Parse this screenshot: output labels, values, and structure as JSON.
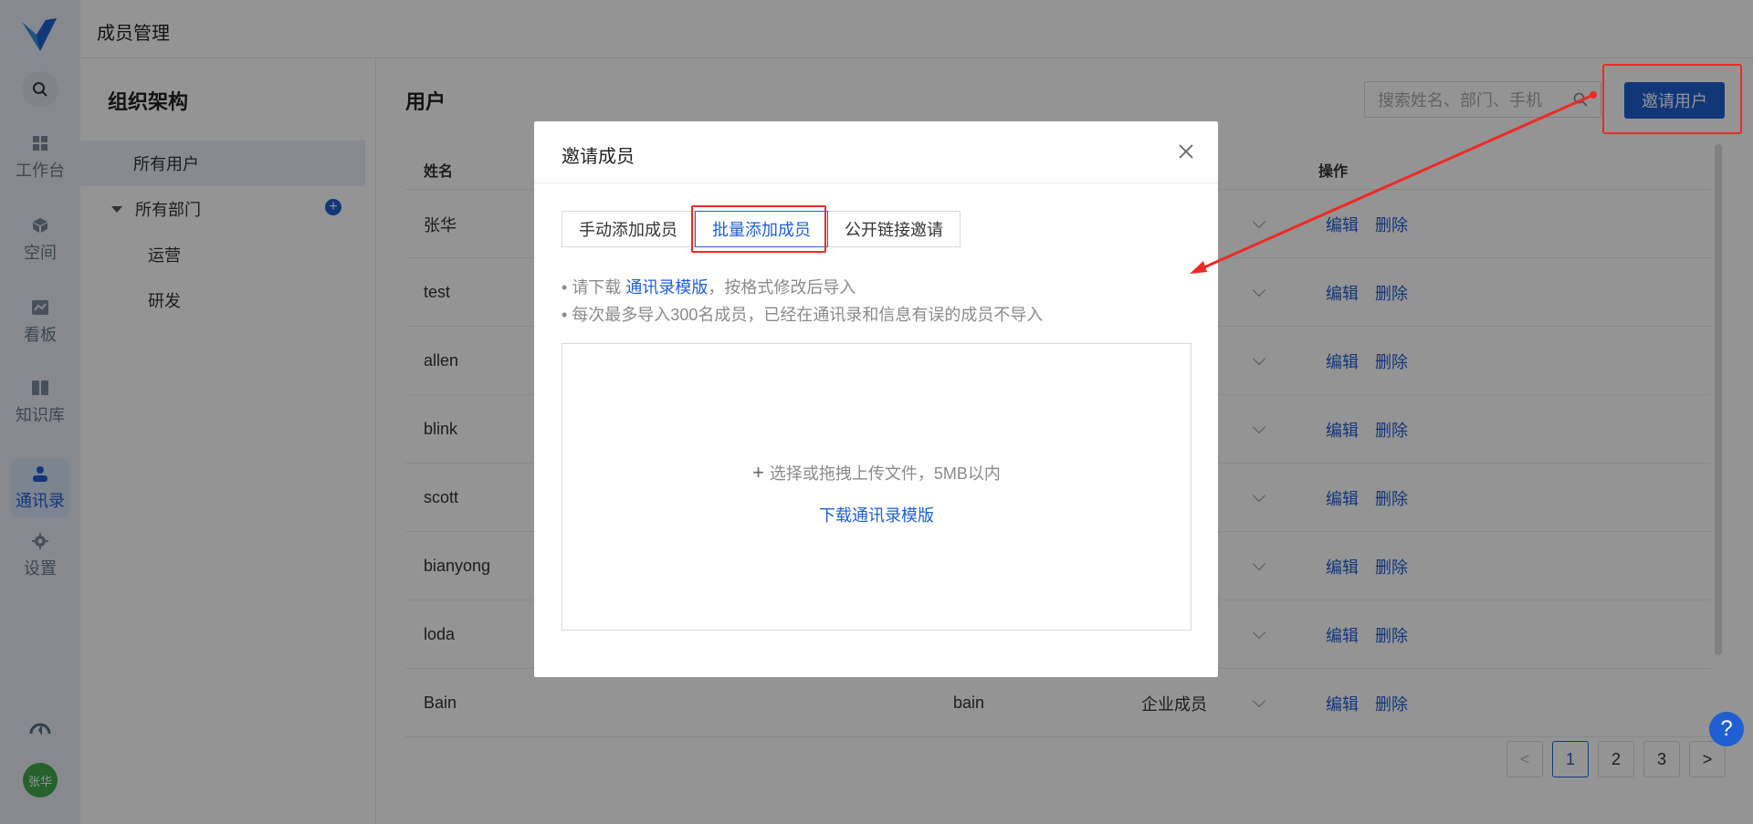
{
  "header": {
    "title": "成员管理"
  },
  "rail": {
    "items": [
      {
        "label": "工作台",
        "icon": "dashboard-icon"
      },
      {
        "label": "空间",
        "icon": "cube-icon"
      },
      {
        "label": "看板",
        "icon": "chart-icon"
      },
      {
        "label": "知识库",
        "icon": "book-icon"
      },
      {
        "label": "通讯录",
        "icon": "contacts-icon"
      },
      {
        "label": "设置",
        "icon": "gear-icon"
      }
    ],
    "avatar": "张华"
  },
  "org": {
    "title": "组织架构",
    "items": [
      {
        "label": "所有用户"
      },
      {
        "label": "所有部门"
      },
      {
        "label": "运营"
      },
      {
        "label": "研发"
      }
    ]
  },
  "main": {
    "title": "用户",
    "search_placeholder": "搜索姓名、部门、手机",
    "invite_label": "邀请用户",
    "columns": {
      "name": "姓名",
      "actions": "操作"
    },
    "rows": [
      {
        "name": "张华",
        "account": "",
        "role": ""
      },
      {
        "name": "test",
        "account": "",
        "role": ""
      },
      {
        "name": "allen",
        "account": "",
        "role": ""
      },
      {
        "name": "blink",
        "account": "",
        "role": ""
      },
      {
        "name": "scott",
        "account": "",
        "role": ""
      },
      {
        "name": "bianyong",
        "account": "",
        "role": ""
      },
      {
        "name": "loda",
        "account": "",
        "role": ""
      },
      {
        "name": "Bain",
        "account": "bain",
        "role": "企业成员"
      }
    ],
    "edit_label": "编辑",
    "delete_label": "删除",
    "pagination": {
      "prev": "<",
      "pages": [
        "1",
        "2",
        "3"
      ],
      "current": "1",
      "next": ">"
    },
    "help_label": "?"
  },
  "modal": {
    "title": "邀请成员",
    "tabs": [
      {
        "label": "手动添加成员"
      },
      {
        "label": "批量添加成员"
      },
      {
        "label": "公开链接邀请"
      }
    ],
    "hint1_prefix": "请下载",
    "hint1_link": "通讯录模版",
    "hint1_suffix": "，按格式修改后导入",
    "hint2": "每次最多导入300名成员，已经在通讯录和信息有误的成员不导入",
    "drop_text": "选择或拖拽上传文件，5MB以内",
    "drop_link": "下载通讯录模版"
  },
  "colors": {
    "primary": "#1f5fd1",
    "annotation": "#ee2a24"
  }
}
